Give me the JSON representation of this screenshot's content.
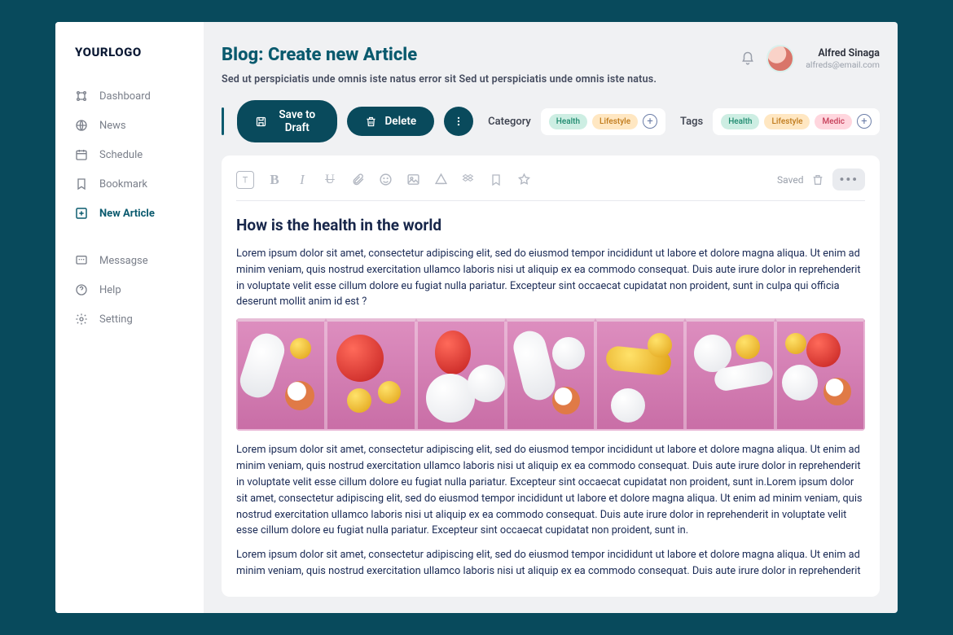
{
  "brand": {
    "logo": "YOURLOGO"
  },
  "sidebar": {
    "items": [
      {
        "label": "Dashboard",
        "icon": "grid-icon",
        "active": false
      },
      {
        "label": "News",
        "icon": "globe-icon",
        "active": false
      },
      {
        "label": "Schedule",
        "icon": "calendar-icon",
        "active": false
      },
      {
        "label": "Bookmark",
        "icon": "bookmark-icon",
        "active": false
      },
      {
        "label": "New Article",
        "icon": "plus-square-icon",
        "active": true
      }
    ],
    "secondary": [
      {
        "label": "Messagse",
        "icon": "message-icon"
      },
      {
        "label": "Help",
        "icon": "help-icon"
      },
      {
        "label": "Setting",
        "icon": "settings-icon"
      }
    ]
  },
  "header": {
    "title": "Blog: Create new Article",
    "subtitle": "Sed ut perspiciatis unde omnis iste natus error sit Sed ut perspiciatis unde omnis iste natus."
  },
  "user": {
    "name": "Alfred Sinaga",
    "email": "alfreds@email.com"
  },
  "actions": {
    "save_label": "Save to Draft",
    "delete_label": "Delete",
    "category_label": "Category",
    "tags_label": "Tags",
    "categories": [
      {
        "text": "Health",
        "cls": "health"
      },
      {
        "text": "Lifestyle",
        "cls": "lifestyle"
      }
    ],
    "tags": [
      {
        "text": "Health",
        "cls": "health"
      },
      {
        "text": "Lifestyle",
        "cls": "lifestyle"
      },
      {
        "text": "Medic",
        "cls": "medic"
      }
    ]
  },
  "editor": {
    "saved_label": "Saved",
    "toolbar_items": [
      "text",
      "bold",
      "italic",
      "underline",
      "attachment",
      "emoji",
      "image",
      "shape",
      "dropbox",
      "bookmark",
      "star"
    ],
    "article_title": "How is the health in the world",
    "p1": "Lorem ipsum dolor sit amet, consectetur adipiscing elit, sed do eiusmod tempor incididunt ut labore et dolore magna aliqua. Ut enim ad minim veniam, quis nostrud exercitation ullamco laboris nisi ut aliquip ex ea commodo consequat. Duis aute irure dolor in reprehenderit in voluptate velit esse cillum dolore eu fugiat nulla pariatur. Excepteur sint occaecat cupidatat non proident, sunt in culpa qui officia deserunt mollit anim id est ?",
    "p2": "Lorem ipsum dolor sit amet, consectetur adipiscing elit, sed do eiusmod tempor incididunt ut labore et dolore magna aliqua. Ut enim ad minim veniam, quis nostrud exercitation ullamco laboris nisi ut aliquip ex ea commodo consequat. Duis aute irure dolor in reprehenderit in voluptate velit esse cillum dolore eu fugiat nulla pariatur. Excepteur sint occaecat cupidatat non proident, sunt in.Lorem ipsum dolor sit amet, consectetur adipiscing elit, sed do eiusmod tempor incididunt ut labore et dolore magna aliqua. Ut enim ad minim veniam, quis nostrud exercitation ullamco laboris nisi ut aliquip ex ea commodo consequat. Duis aute irure dolor in reprehenderit in voluptate velit esse cillum dolore eu fugiat nulla pariatur. Excepteur sint occaecat cupidatat non proident, sunt in.",
    "p3": "Lorem ipsum dolor sit amet, consectetur adipiscing elit, sed do eiusmod tempor incididunt ut labore et dolore magna aliqua. Ut enim ad minim veniam, quis nostrud exercitation ullamco laboris nisi ut aliquip ex ea commodo consequat. Duis aute irure dolor in reprehenderit in voluptate velit esse cillum dolore eu fugiat nulla pariatur. Excepteur sint occaecat cupidatat non proident, sunt in."
  }
}
